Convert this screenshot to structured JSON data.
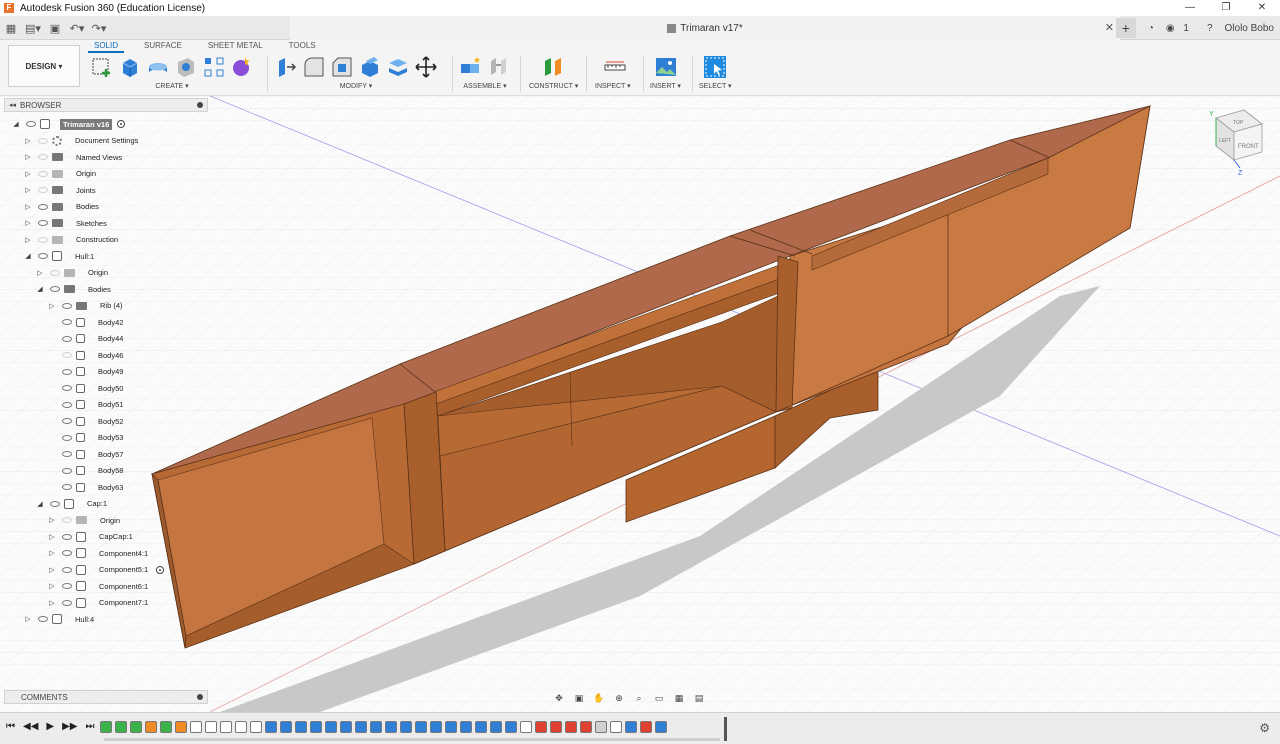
{
  "window": {
    "title": "Autodesk Fusion 360 (Education License)",
    "controls": [
      "—",
      "❐",
      "✕"
    ]
  },
  "tabbar": {
    "doc_title": "Trimaran v17*",
    "close": "✕",
    "new_tab": "+",
    "user_count": "1",
    "user_name": "Ololo Bobo"
  },
  "ribbon": {
    "workspace": "DESIGN ▾",
    "tabs": [
      "SOLID",
      "SURFACE",
      "SHEET METAL",
      "TOOLS"
    ],
    "groups": {
      "create": "CREATE ▾",
      "modify": "MODIFY ▾",
      "assemble": "ASSEMBLE ▾",
      "construct": "CONSTRUCT ▾",
      "inspect": "INSPECT ▾",
      "insert": "INSERT ▾",
      "select": "SELECT ▾"
    }
  },
  "browser": {
    "title": "BROWSER",
    "items": [
      {
        "label": "Trimaran v16",
        "indent": 0,
        "expanded": true,
        "icon": "component",
        "visible": true,
        "root": true
      },
      {
        "label": "Document Settings",
        "indent": 1,
        "icon": "gear",
        "visible": false
      },
      {
        "label": "Named Views",
        "indent": 1,
        "icon": "folder",
        "visible": false
      },
      {
        "label": "Origin",
        "indent": 1,
        "icon": "folder-light",
        "visible": false
      },
      {
        "label": "Joints",
        "indent": 1,
        "icon": "folder",
        "visible": false
      },
      {
        "label": "Bodies",
        "indent": 1,
        "icon": "folder",
        "visible": true
      },
      {
        "label": "Sketches",
        "indent": 1,
        "icon": "folder",
        "visible": true
      },
      {
        "label": "Construction",
        "indent": 1,
        "icon": "folder-light",
        "visible": false
      },
      {
        "label": "Hull:1",
        "indent": 1,
        "expanded": true,
        "icon": "component",
        "visible": true
      },
      {
        "label": "Origin",
        "indent": 2,
        "icon": "folder-light",
        "visible": false
      },
      {
        "label": "Bodies",
        "indent": 2,
        "expanded": true,
        "icon": "folder",
        "visible": true
      },
      {
        "label": "Rib (4)",
        "indent": 3,
        "icon": "folder",
        "visible": true
      },
      {
        "label": "Body42",
        "indent": 3,
        "icon": "body",
        "visible": true,
        "leaf": true
      },
      {
        "label": "Body44",
        "indent": 3,
        "icon": "body",
        "visible": true,
        "leaf": true
      },
      {
        "label": "Body46",
        "indent": 3,
        "icon": "body",
        "visible": false,
        "leaf": true
      },
      {
        "label": "Body49",
        "indent": 3,
        "icon": "body",
        "visible": true,
        "leaf": true
      },
      {
        "label": "Body50",
        "indent": 3,
        "icon": "body",
        "visible": true,
        "leaf": true
      },
      {
        "label": "Body51",
        "indent": 3,
        "icon": "body",
        "visible": true,
        "leaf": true
      },
      {
        "label": "Body52",
        "indent": 3,
        "icon": "body",
        "visible": true,
        "leaf": true
      },
      {
        "label": "Body53",
        "indent": 3,
        "icon": "body",
        "visible": true,
        "leaf": true
      },
      {
        "label": "Body57",
        "indent": 3,
        "icon": "body",
        "visible": true,
        "leaf": true
      },
      {
        "label": "Body58",
        "indent": 3,
        "icon": "body",
        "visible": true,
        "leaf": true
      },
      {
        "label": "Body63",
        "indent": 3,
        "icon": "body",
        "visible": true,
        "leaf": true
      },
      {
        "label": "Cap:1",
        "indent": 2,
        "expanded": true,
        "icon": "component",
        "visible": true
      },
      {
        "label": "Origin",
        "indent": 3,
        "icon": "folder-light",
        "visible": false
      },
      {
        "label": "CapCap:1",
        "indent": 3,
        "icon": "component",
        "visible": true
      },
      {
        "label": "Component4:1",
        "indent": 3,
        "icon": "component",
        "visible": true
      },
      {
        "label": "Component5:1",
        "indent": 3,
        "icon": "component",
        "visible": true,
        "activate": true
      },
      {
        "label": "Component6:1",
        "indent": 3,
        "icon": "component",
        "visible": true
      },
      {
        "label": "Component7:1",
        "indent": 3,
        "icon": "component",
        "visible": true
      },
      {
        "label": "Hull:4",
        "indent": 1,
        "icon": "component",
        "visible": true
      }
    ]
  },
  "comments": {
    "title": "COMMENTS"
  },
  "viewcube": {
    "top": "TOP",
    "front": "FRONT",
    "left": "LEFT",
    "axis_x": "X",
    "axis_y": "Y",
    "axis_z": "Z"
  },
  "colors": {
    "hull_top": "#b0694a",
    "hull_side": "#c5753f",
    "hull_dark": "#9c5a2d",
    "hull_inner": "#b86a34",
    "shadow": "#c8c8c8",
    "accent": "#0b6dbf"
  }
}
